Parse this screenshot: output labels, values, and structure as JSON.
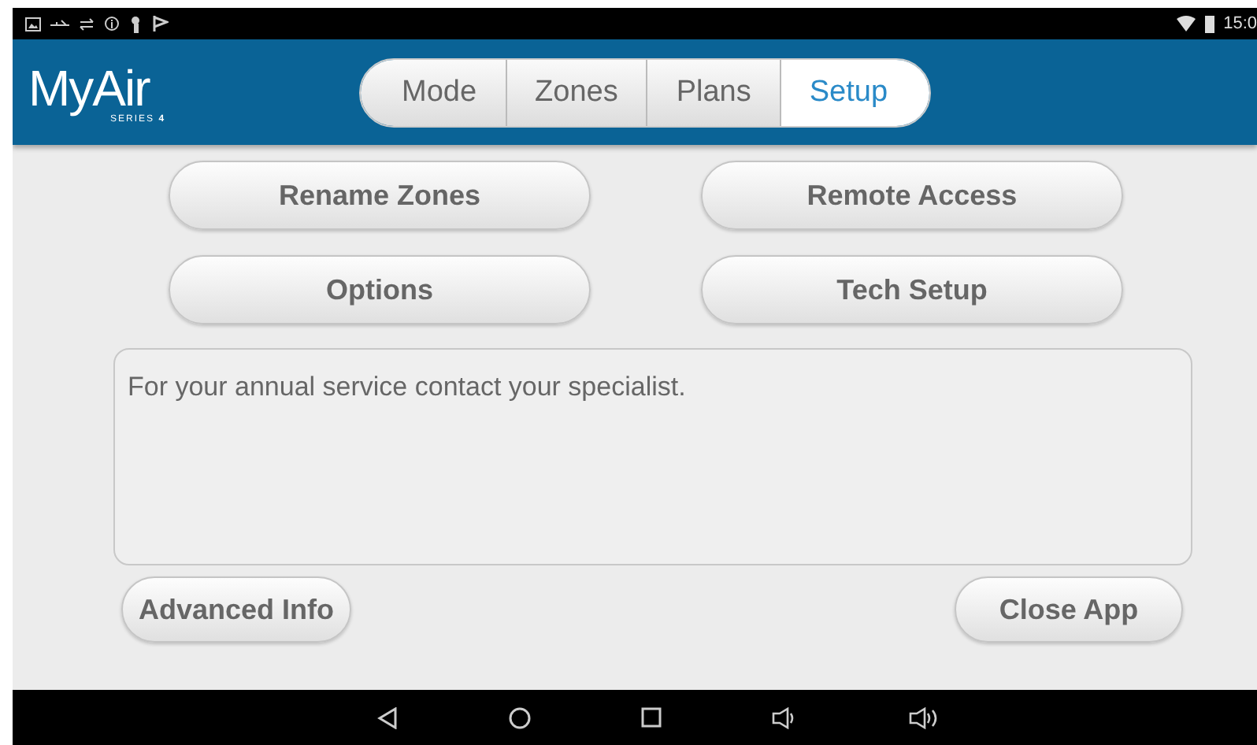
{
  "status_bar": {
    "time": "15:0"
  },
  "logo": {
    "name": "MyAir",
    "subtitle": "SERIES **4**"
  },
  "tabs": [
    {
      "label": "Mode",
      "selected": false
    },
    {
      "label": "Zones",
      "selected": false
    },
    {
      "label": "Plans",
      "selected": false
    },
    {
      "label": "Setup",
      "selected": true
    }
  ],
  "setup_buttons": [
    "Rename Zones",
    "Remote Access",
    "Options",
    "Tech Setup"
  ],
  "message": "For your annual service contact your specialist.",
  "footer_buttons": [
    "Advanced Info",
    "Close App"
  ]
}
